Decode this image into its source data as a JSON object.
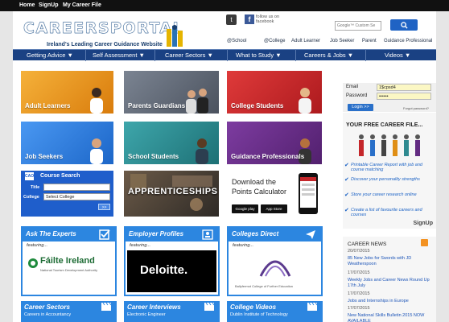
{
  "topbar": {
    "links": [
      "Home",
      "SignUp",
      "My Career File"
    ]
  },
  "header": {
    "logo_text": "CAREERSPORTAL",
    "logo_tagline": "Ireland's Leading Career Guidance Website",
    "social": {
      "twitter_icon": "t",
      "facebook_icon": "f",
      "facebook_text": "follow us on facebook"
    },
    "search": {
      "placeholder": "Google™ Custom Se",
      "button_icon": "search-icon"
    },
    "audience_links": [
      "@School",
      "@College",
      "Adult Learner",
      "Job Seeker",
      "Parent",
      "Guidance Professional"
    ]
  },
  "nav": {
    "items": [
      "Getting Advice ▼",
      "Self Assessment ▼",
      "Career Sectors ▼",
      "What to Study ▼",
      "Careers & Jobs ▼",
      "Videos ▼"
    ]
  },
  "tiles": {
    "adult_learners": "Adult Learners",
    "parents_guardians": "Parents Guardians",
    "college_students": "College Students",
    "job_seekers": "Job Seekers",
    "school_students": "School Students",
    "guidance_professionals": "Guidance Professionals",
    "apprenticeships": "APPRENTICESHIPS",
    "points_calc_line1": "Download the",
    "points_calc_line2": "Points Calculator",
    "google_play": "Google play",
    "app_store": "App Store"
  },
  "course_search": {
    "logo": "CAO",
    "title": "Course Search",
    "title_label": "Title",
    "college_label": "College",
    "college_selected": "Select College",
    "go_button": ">>"
  },
  "login": {
    "email_label": "Email",
    "email_value": "1$cpsd4",
    "password_label": "Password",
    "password_value": "••••••",
    "login_button": "Login >>",
    "forgot": "Forgot password?"
  },
  "career_file": {
    "title": "YOUR FREE CAREER FILE...",
    "items": [
      "Printable Career Report with job and course matching",
      "Discover your personality strengths",
      "Store your career research online",
      "Create a list of favourite careers and courses"
    ],
    "signup": "SignUp"
  },
  "news": {
    "title": "CAREER NEWS",
    "items": [
      {
        "date": "20/07/2015",
        "headline": "85 New Jobs for Swords with JD Weatherspoon"
      },
      {
        "date": "17/07/2015",
        "headline": "Weekly Jobs and Career News Round Up 17th July"
      },
      {
        "date": "17/07/2015",
        "headline": "Jobs and Internships in Europe"
      },
      {
        "date": "17/07/2015",
        "headline": "New National Skills Bulletin 2015 NOW AVAILABLE"
      }
    ]
  },
  "features": [
    {
      "title": "Ask The Experts",
      "sub": "featuring...",
      "brand_main": "Fáilte Ireland",
      "brand_sub": "National Tourism Development Authority"
    },
    {
      "title": "Employer Profiles",
      "sub": "featuring...",
      "brand_main": "Deloitte."
    },
    {
      "title": "Colleges Direct",
      "sub": "featuring...",
      "brand_main": "Ballyfermot College of Further Education"
    }
  ],
  "bottom_boxes": [
    {
      "title": "Career Sectors",
      "sub": "Careers in Accountancy"
    },
    {
      "title": "Career Interviews",
      "sub": "Electronic Engineer"
    },
    {
      "title": "College Videos",
      "sub": "Dublin Institute of Technology"
    }
  ],
  "colors": {
    "nav": "#1a4183",
    "accent": "#2c86e0",
    "adult": "#e08f16",
    "parents": "#5c6472",
    "college": "#c4262a",
    "jobseekers": "#2f7ee0",
    "school": "#2f8a90",
    "guidance": "#632b82"
  }
}
